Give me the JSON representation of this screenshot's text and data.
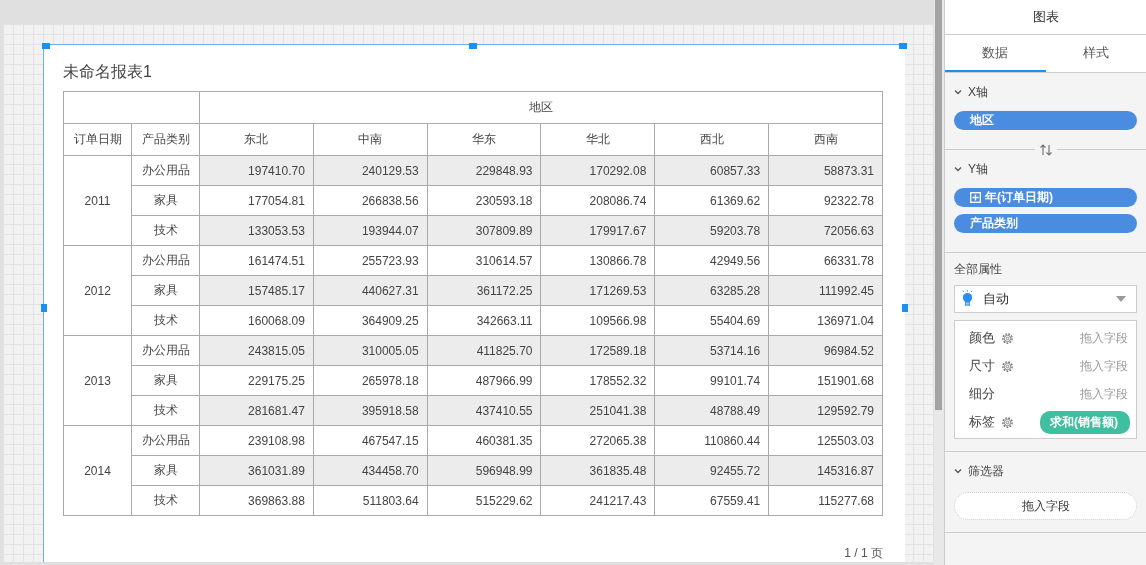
{
  "report": {
    "title": "未命名报表1",
    "region_header": "地区",
    "row_headers": [
      "订单日期",
      "产品类别"
    ],
    "regions": [
      "东北",
      "中南",
      "华东",
      "华北",
      "西北",
      "西南"
    ],
    "groups": [
      {
        "year": "2011",
        "rows": [
          {
            "category": "办公用品",
            "values": [
              "197410.70",
              "240129.53",
              "229848.93",
              "170292.08",
              "60857.33",
              "58873.31"
            ]
          },
          {
            "category": "家具",
            "values": [
              "177054.81",
              "266838.56",
              "230593.18",
              "208086.74",
              "61369.62",
              "92322.78"
            ]
          },
          {
            "category": "技术",
            "values": [
              "133053.53",
              "193944.07",
              "307809.89",
              "179917.67",
              "59203.78",
              "72056.63"
            ]
          }
        ]
      },
      {
        "year": "2012",
        "rows": [
          {
            "category": "办公用品",
            "values": [
              "161474.51",
              "255723.93",
              "310614.57",
              "130866.78",
              "42949.56",
              "66331.78"
            ]
          },
          {
            "category": "家具",
            "values": [
              "157485.17",
              "440627.31",
              "361172.25",
              "171269.53",
              "63285.28",
              "111992.45"
            ]
          },
          {
            "category": "技术",
            "values": [
              "160068.09",
              "364909.25",
              "342663.11",
              "109566.98",
              "55404.69",
              "136971.04"
            ]
          }
        ]
      },
      {
        "year": "2013",
        "rows": [
          {
            "category": "办公用品",
            "values": [
              "243815.05",
              "310005.05",
              "411825.70",
              "172589.18",
              "53714.16",
              "96984.52"
            ]
          },
          {
            "category": "家具",
            "values": [
              "229175.25",
              "265978.18",
              "487966.99",
              "178552.32",
              "99101.74",
              "151901.68"
            ]
          },
          {
            "category": "技术",
            "values": [
              "281681.47",
              "395918.58",
              "437410.55",
              "251041.38",
              "48788.49",
              "129592.79"
            ]
          }
        ]
      },
      {
        "year": "2014",
        "rows": [
          {
            "category": "办公用品",
            "values": [
              "239108.98",
              "467547.15",
              "460381.35",
              "272065.38",
              "110860.44",
              "125503.03"
            ]
          },
          {
            "category": "家具",
            "values": [
              "361031.89",
              "434458.70",
              "596948.99",
              "361835.48",
              "92455.72",
              "145316.87"
            ]
          },
          {
            "category": "技术",
            "values": [
              "369863.88",
              "511803.64",
              "515229.62",
              "241217.43",
              "67559.41",
              "115277.68"
            ]
          }
        ]
      }
    ],
    "pager": "1 / 1 页"
  },
  "panel": {
    "title": "图表",
    "tabs": [
      {
        "label": "数据",
        "selected": true
      },
      {
        "label": "样式",
        "selected": false
      }
    ],
    "x_axis": {
      "label": "X轴",
      "expanded": true,
      "fields": [
        {
          "label": "地区",
          "kind": "plain"
        }
      ]
    },
    "y_axis": {
      "label": "Y轴",
      "expanded": true,
      "fields": [
        {
          "label": "年(订单日期)",
          "kind": "hierarchy"
        },
        {
          "label": "产品类别",
          "kind": "plain"
        }
      ]
    },
    "properties": {
      "label": "全部属性",
      "mark_type": "自动",
      "slots": [
        {
          "label": "颜色",
          "settings": true,
          "placeholder": "拖入字段"
        },
        {
          "label": "尺寸",
          "settings": true,
          "placeholder": "拖入字段"
        },
        {
          "label": "细分",
          "settings": false,
          "placeholder": "拖入字段"
        },
        {
          "label": "标签",
          "settings": true,
          "field": "求和(销售额)"
        }
      ]
    },
    "filters": {
      "label": "筛选器",
      "expanded": true,
      "drop_target": "拖入字段"
    }
  }
}
